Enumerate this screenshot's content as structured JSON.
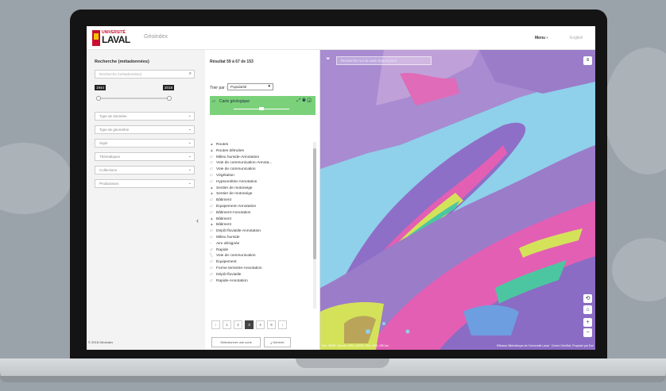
{
  "header": {
    "logo_top": "UNIVERSITÉ",
    "logo_main": "LAVAL",
    "app_name": "Géoindex",
    "menu": "Menu  ›",
    "lang": "English"
  },
  "left": {
    "title": "Recherche (métadonnées)",
    "search_placeholder": "Recherche (métadonnées)",
    "year_min": "1944",
    "year_max": "2018",
    "year_range_fraction": [
      0.0,
      1.0
    ],
    "filters": [
      "Type de données",
      "Type de géométrie",
      "Sujet",
      "Thématiques",
      "Collections",
      "Producteurs"
    ],
    "copyright": "© 2018 Géoindex"
  },
  "mid": {
    "result": "Résultat 59 à 67 de 153",
    "sort_label": "Trier par :",
    "sort_value": "Popularité",
    "active_layer": "Carte géologique",
    "layers": [
      "Routes",
      "Routes détruites",
      "Milieu humide-Annotation",
      "Voie de communication-Annota...",
      "Voie de communication",
      "Végétation",
      "Hypsométrie-Annotation",
      "Sentier de motoneige",
      "Sentier de motoneige",
      "Bâtiment",
      "Équipement-Annotation",
      "Bâtiment-Annotation",
      "Bâtiment",
      "Bâtiment",
      "Dépôt fluviatile-Annotation",
      "Milieu humide",
      "Aire désignée",
      "Rapide",
      "Voie de communication",
      "Équipement",
      "Forme terrestre-Annotation",
      "Dépôt fluviatile",
      "Rapide-Annotation"
    ],
    "pages": [
      "‹",
      "1",
      "2",
      "3",
      "4",
      "5",
      "›"
    ],
    "active_page": "3",
    "btn_select": "Sélectionner une zone",
    "btn_download": "Générer"
  },
  "map": {
    "search_placeholder": "Recherche sur la carte (toponymie)",
    "attr_left": "Esri, HERE, Garmin, NGA, USGS, EPA, NPS, NRCan",
    "attr_right": "Diffusion Bibliothèque de l'Université Laval · Centre GéoStat, Propulsé par Esri",
    "zoom_in": "+",
    "zoom_out": "−"
  },
  "colors": {
    "brand_red": "#c8102e",
    "active_layer_green": "#7bd17a",
    "water": "#8fd0ea"
  }
}
